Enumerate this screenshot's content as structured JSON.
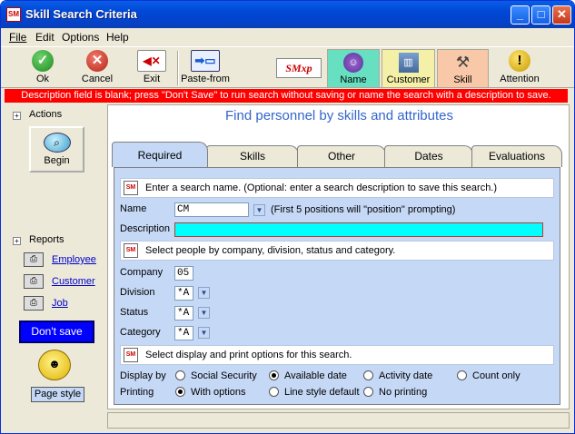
{
  "window": {
    "title": "Skill Search Criteria",
    "icon_text": "SM"
  },
  "menu": [
    "File",
    "Edit",
    "Options",
    "Help"
  ],
  "toolbar": {
    "ok": "Ok",
    "cancel": "Cancel",
    "exit": "Exit",
    "paste": "Paste-from",
    "logo": "SMxp",
    "name": "Name",
    "customer": "Customer",
    "skill": "Skill",
    "attention": "Attention"
  },
  "alert": "Description field is blank; press \"Don't Save\" to run search without saving or name the search with a description to save.",
  "left": {
    "actions": "Actions",
    "begin": "Begin",
    "reports": "Reports",
    "employee": "Employee",
    "customer": "Customer",
    "job": "Job",
    "dont_save": "Don't save",
    "page_style": "Page style"
  },
  "main": {
    "title": "Find personnel by skills and attributes",
    "tabs": [
      "Required",
      "Skills",
      "Other",
      "Dates",
      "Evaluations"
    ],
    "section1": "Enter a search name.  (Optional: enter a search description to save this search.)",
    "name_label": "Name",
    "name_value": "CM",
    "name_hint": "(First 5 positions will \"position\" prompting)",
    "desc_label": "Description",
    "desc_value": "",
    "section2": "Select people by company, division, status and category.",
    "company_label": "Company",
    "company_value": "05",
    "division_label": "Division",
    "division_value": "*A",
    "status_label": "Status",
    "status_value": "*A",
    "category_label": "Category",
    "category_value": "*A",
    "section3": "Select display and print options for this search.",
    "display_label": "Display by",
    "display_options": [
      "Social Security",
      "Available date",
      "Activity date",
      "Count only"
    ],
    "display_selected": "Available date",
    "printing_label": "Printing",
    "printing_options": [
      "With options",
      "Line style default",
      "No printing"
    ],
    "printing_selected": "With options"
  },
  "colors": {
    "accent": "#3366cc",
    "alert": "#ff0000",
    "desc_field": "#00ffff",
    "tab_body": "#c5d8f5",
    "dont_save_bg": "#0000ff"
  }
}
